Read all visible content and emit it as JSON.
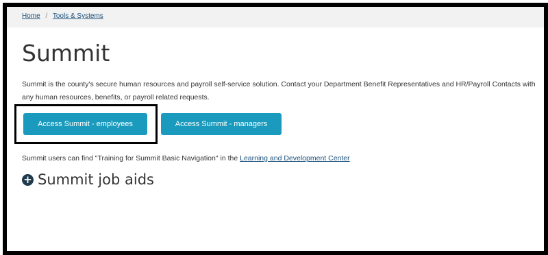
{
  "breadcrumb": {
    "items": [
      "Home",
      "Tools & Systems"
    ],
    "separator": "/"
  },
  "page": {
    "title": "Summit",
    "description": "Summit is the county's secure human resources and payroll self-service solution. Contact your Department Benefit Representatives and HR/Payroll Contacts with any human resources, benefits, or payroll related requests."
  },
  "buttons": {
    "employees": "Access Summit - employees",
    "managers": "Access Summit - managers"
  },
  "note": {
    "text": "Summit users can find \"Training for Summit Basic Navigation\" in the ",
    "link": "Learning and Development Center"
  },
  "job_aids": {
    "label": "Summit job aids",
    "icon": "plus-circle-icon",
    "icon_glyph": "+"
  },
  "colors": {
    "button": "#1a9bbd",
    "link": "#1a4f7a",
    "icon": "#1f3a4d"
  }
}
